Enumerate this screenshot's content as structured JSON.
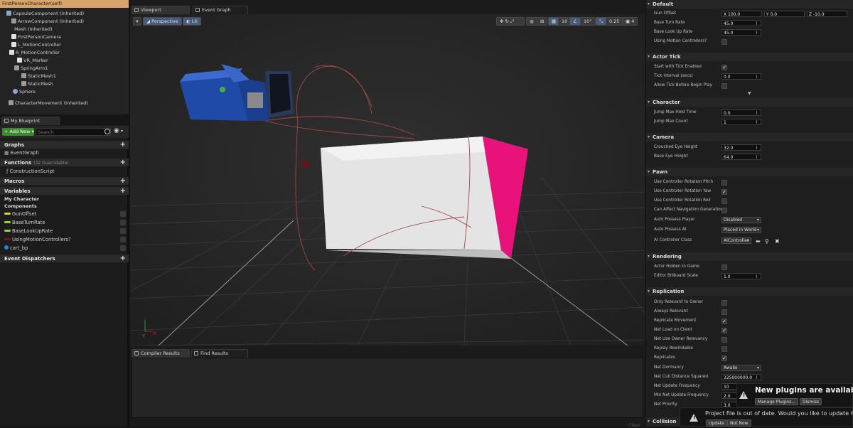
{
  "components": {
    "items": [
      {
        "label": "FirstPersonCharacter(self)",
        "indent": 0,
        "selected": true
      },
      {
        "label": "CapsuleComponent (Inherited)",
        "indent": 1
      },
      {
        "label": "ArrowComponent (Inherited)",
        "indent": 2
      },
      {
        "label": "Mesh (Inherited)",
        "indent": 2
      },
      {
        "label": "FirstPersonCamera",
        "indent": 2
      },
      {
        "label": "L_MotionController",
        "indent": 2
      },
      {
        "label": "R_MotionController",
        "indent": 2
      },
      {
        "label": "VR_Marker",
        "indent": 3
      },
      {
        "label": "SpringArm1",
        "indent": 3
      },
      {
        "label": "StaticMesh1",
        "indent": 4
      },
      {
        "label": "StaticMesh",
        "indent": 4
      },
      {
        "label": "Sphere",
        "indent": 2
      },
      {
        "label": "CharacterMovement (Inherited)",
        "indent": 1
      }
    ]
  },
  "my_blueprint": {
    "tab_label": "My Blueprint",
    "add_new_label": "Add New",
    "search_placeholder": "Search",
    "graphs_label": "Graphs",
    "event_graph_label": "EventGraph",
    "functions_label": "Functions",
    "functions_count": "(32 Overridable)",
    "construction_script_label": "ConstructionScript",
    "macros_label": "Macros",
    "variables_label": "Variables",
    "my_character_label": "My Character",
    "components_label": "Components",
    "variables": [
      {
        "label": "GunOffset",
        "color": "#e8c62a"
      },
      {
        "label": "BaseTurnRate",
        "color": "#9ad62a"
      },
      {
        "label": "BaseLookUpRate",
        "color": "#9ad62a"
      },
      {
        "label": "UsingMotionControllers?",
        "color": "#8a1010"
      },
      {
        "label": "cart_bp",
        "color": "#1e8ae8"
      }
    ],
    "event_dispatchers_label": "Event Dispatchers"
  },
  "editor": {
    "viewport_tab": "Viewport",
    "event_graph_tab": "Event Graph",
    "perspective_label": "Perspective",
    "lit_label": "Lit",
    "grid_snap": "10",
    "rotation_snap": "10°",
    "scale_snap": "0.25",
    "camera_speed": "4",
    "compiler_results_tab": "Compiler Results",
    "find_results_tab": "Find Results",
    "clear_label": "Clear",
    "axis_x": "X",
    "axis_y": "Y"
  },
  "details": {
    "default_label": "Default",
    "gun_offset_label": "Gun Offset",
    "gun_offset_x": "X 100.0",
    "gun_offset_y": "Y 0.0",
    "gun_offset_z": "Z -10.0",
    "base_turn_rate_label": "Base Turn Rate",
    "base_turn_rate": "45.0",
    "base_look_up_rate_label": "Base Look Up Rate",
    "base_look_up_rate": "45.0",
    "using_motion_controllers_label": "Using Motion Controllers?",
    "actor_tick_label": "Actor Tick",
    "start_with_tick_label": "Start with Tick Enabled",
    "tick_interval_label": "Tick Interval (secs)",
    "tick_interval": "0.0",
    "allow_tick_label": "Allow Tick Before Begin Play",
    "character_label": "Character",
    "jump_max_hold_label": "Jump Max Hold Time",
    "jump_max_hold": "0.0",
    "jump_max_count_label": "Jump Max Count",
    "jump_max_count": "1",
    "camera_label": "Camera",
    "crouched_eye_label": "Crouched Eye Height",
    "crouched_eye": "32.0",
    "base_eye_label": "Base Eye Height",
    "base_eye": "64.0",
    "pawn_label": "Pawn",
    "use_pitch_label": "Use Controller Rotation Pitch",
    "use_yaw_label": "Use Controller Rotation Yaw",
    "use_roll_label": "Use Controller Rotation Roll",
    "can_affect_nav_label": "Can Affect Navigation Generation",
    "auto_possess_player_label": "Auto Possess Player",
    "auto_possess_player": "Disabled",
    "auto_possess_ai_label": "Auto Possess AI",
    "auto_possess_ai": "Placed in World",
    "ai_controller_class_label": "AI Controller Class",
    "ai_controller_class": "AIController",
    "rendering_label": "Rendering",
    "actor_hidden_label": "Actor Hidden In Game",
    "billboard_scale_label": "Editor Billboard Scale",
    "billboard_scale": "1.0",
    "replication_label": "Replication",
    "only_relevant_label": "Only Relevant to Owner",
    "always_relevant_label": "Always Relevant",
    "replicate_movement_label": "Replicate Movement",
    "net_load_label": "Net Load on Client",
    "net_use_owner_label": "Net Use Owner Relevancy",
    "replay_rewindable_label": "Replay Rewindable",
    "replicates_label": "Replicates",
    "net_dormancy_label": "Net Dormancy",
    "net_dormancy": "Awake",
    "net_cull_label": "Net Cull Distance Squared",
    "net_cull": "225000000.0",
    "net_update_label": "Net Update Frequency",
    "net_update": "10",
    "min_net_update_label": "Min Net Update Frequency",
    "min_net_update": "2.0",
    "net_priority_label": "Net Priority",
    "net_priority": "3.0",
    "collision_label": "Collision"
  },
  "toasts": {
    "plugins_message": "New plugins are available",
    "manage_plugins_label": "Manage Plugins...",
    "dismiss_label": "Dismiss",
    "project_message": "Project file is out of date. Would you like to update it?",
    "update_label": "Update",
    "not_now_label": "Not Now"
  }
}
